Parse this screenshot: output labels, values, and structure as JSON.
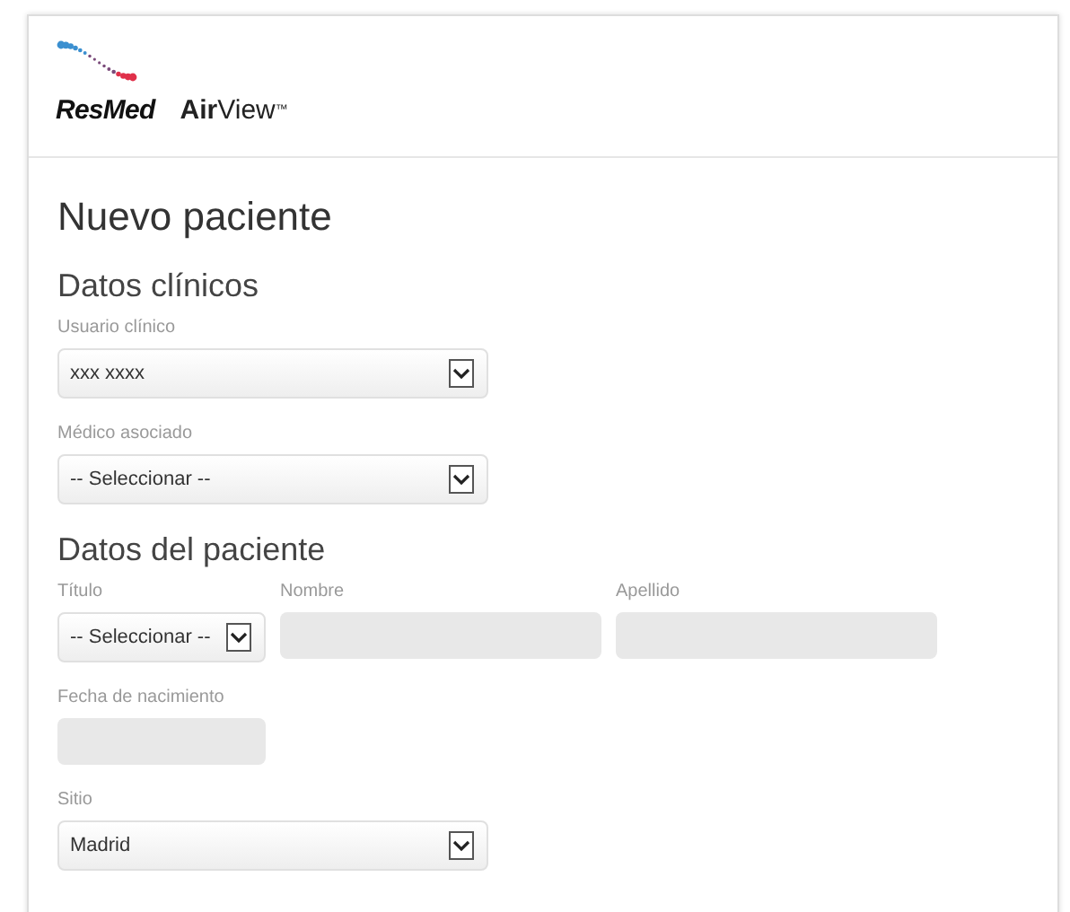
{
  "header": {
    "brand": "ResMed",
    "product_bold": "Air",
    "product_light": "View",
    "trademark": "™"
  },
  "title": "Nuevo paciente",
  "sections": [
    {
      "heading": "Datos clínicos",
      "rows": [
        [
          {
            "kind": "select",
            "label": "Usuario clínico",
            "value": "xxx xxxx"
          }
        ],
        [
          {
            "kind": "select",
            "label": "Médico asociado",
            "value": "-- Seleccionar --"
          }
        ]
      ]
    },
    {
      "heading": "Datos del paciente",
      "rows": [
        [
          {
            "kind": "select",
            "label": "Título",
            "value": "-- Seleccionar --"
          },
          {
            "kind": "text",
            "label": "Nombre"
          },
          {
            "kind": "text",
            "label": "Apellido"
          }
        ],
        [
          {
            "kind": "text",
            "label": "Fecha de nacimiento"
          }
        ],
        [
          {
            "kind": "select",
            "label": "Sitio",
            "value": "Madrid"
          }
        ]
      ]
    }
  ]
}
